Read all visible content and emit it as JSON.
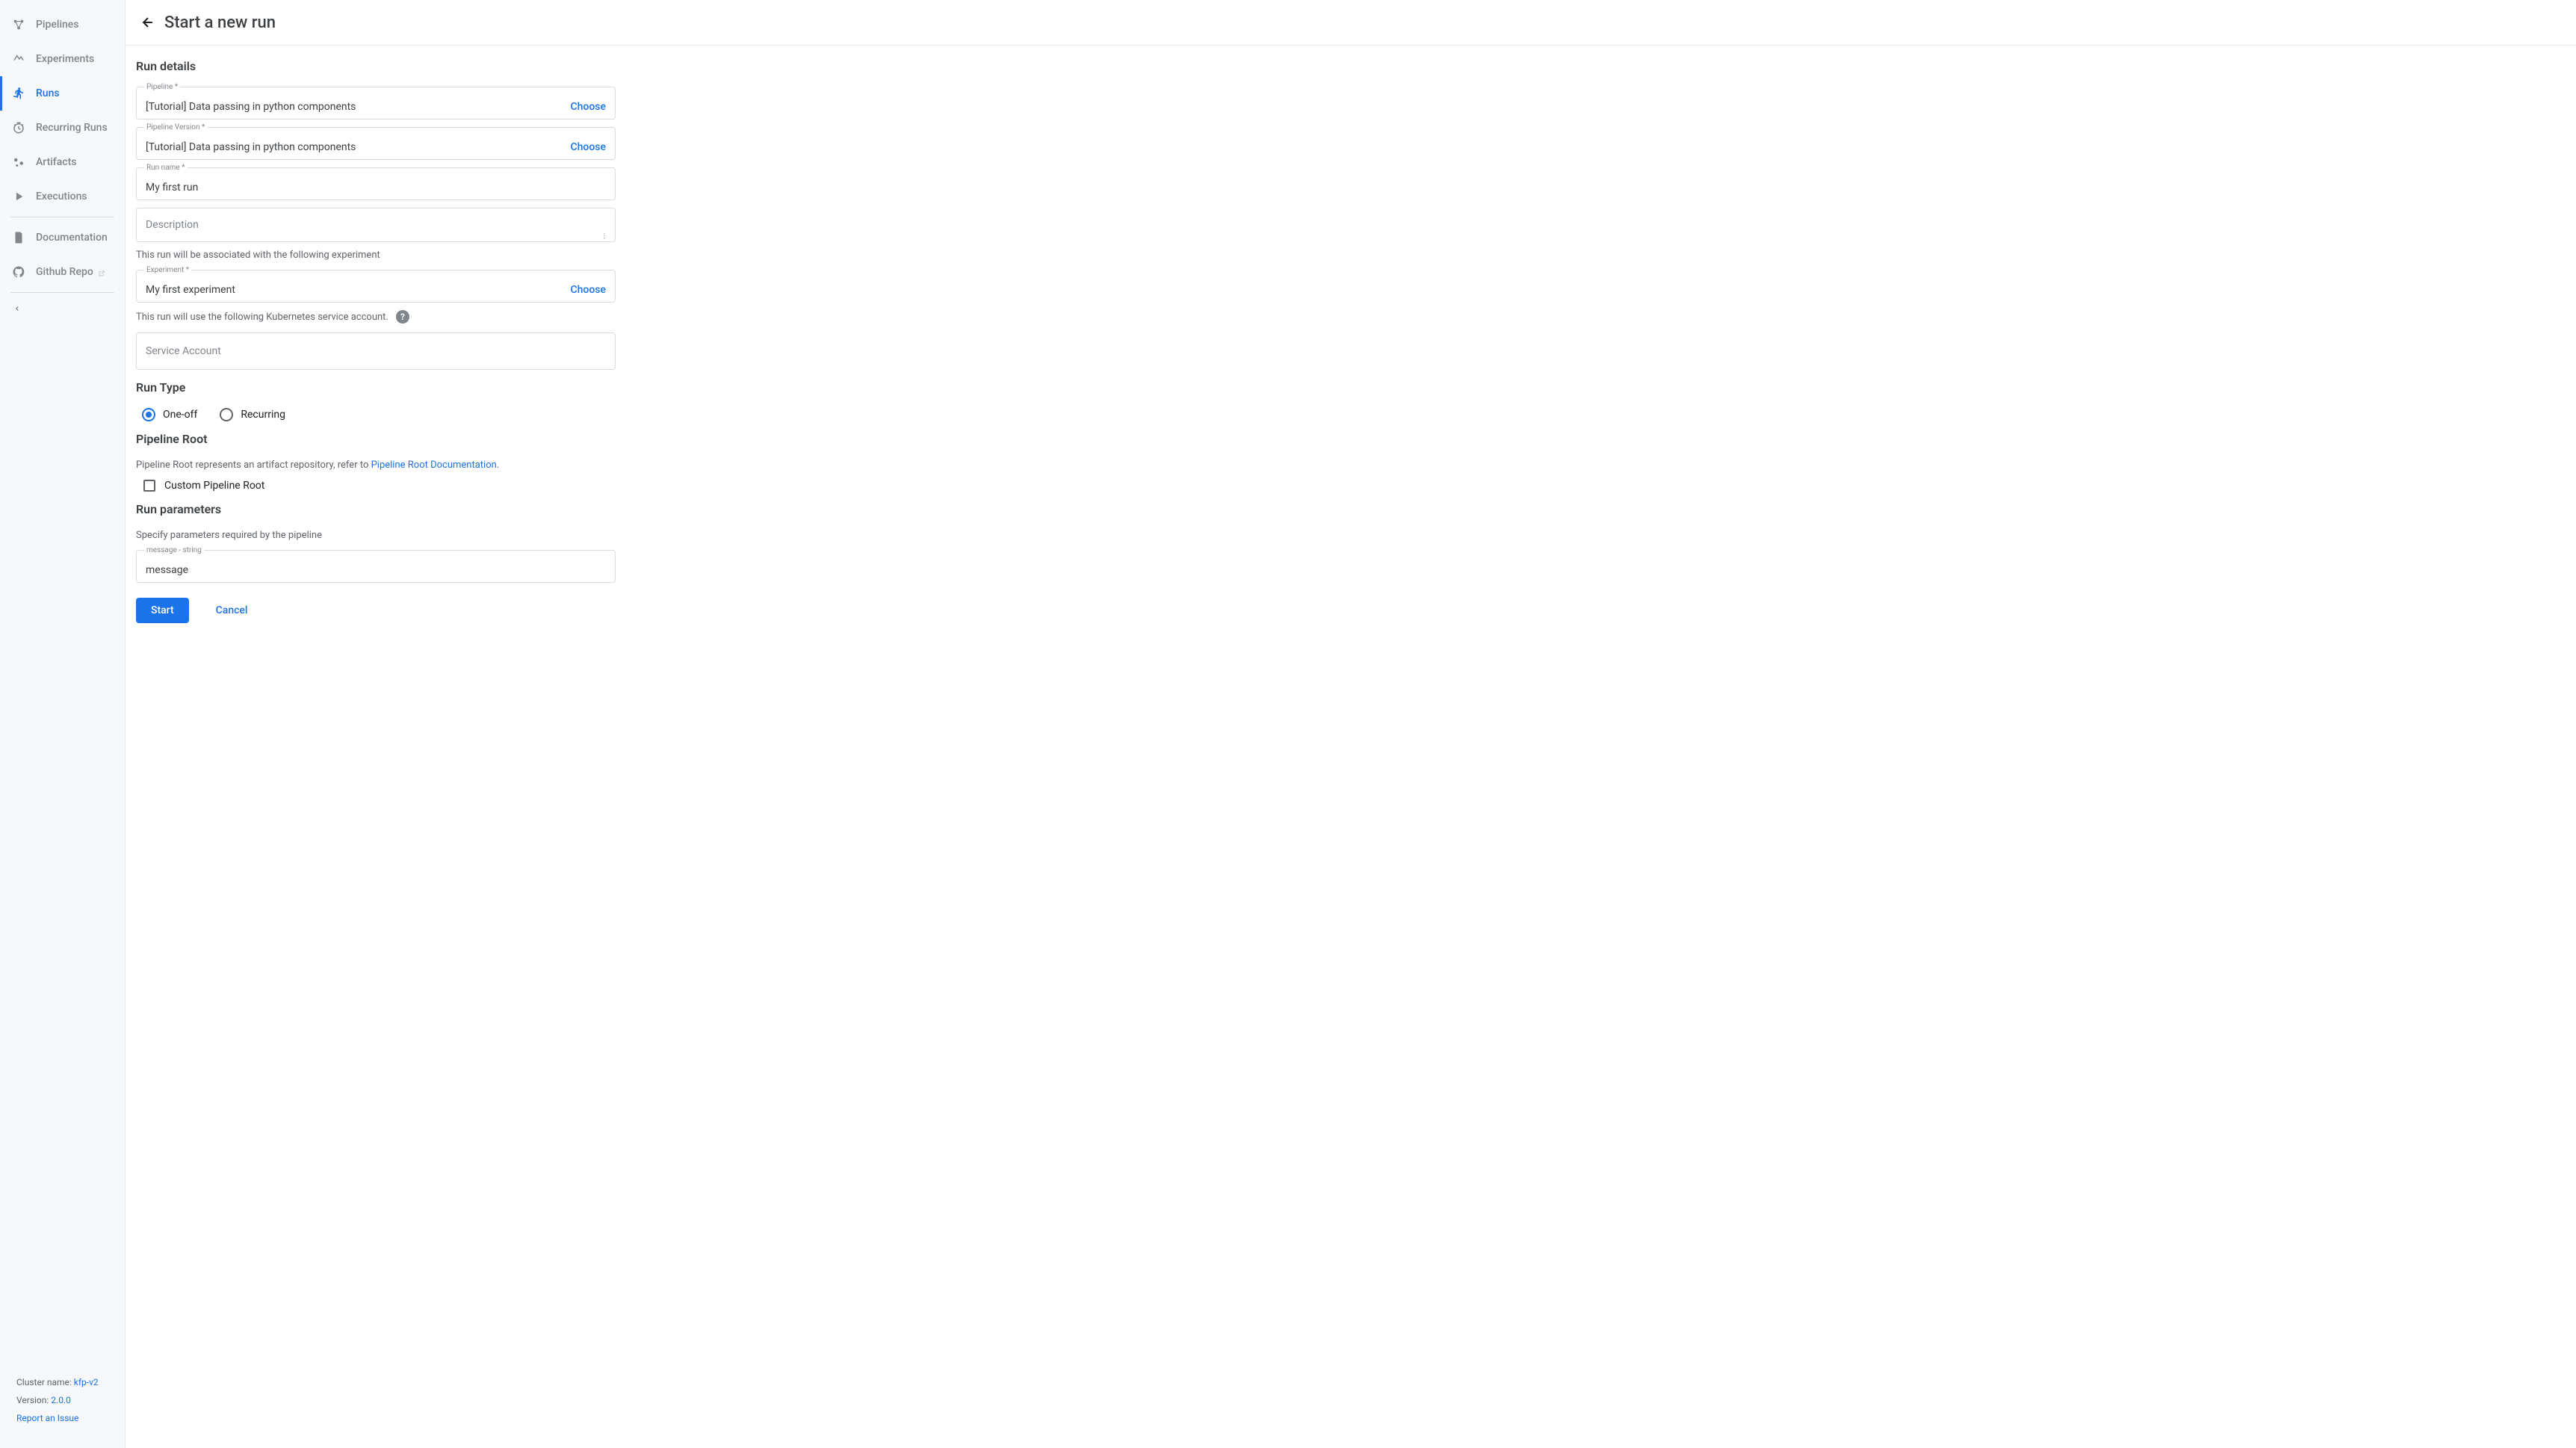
{
  "sidebar": {
    "items": [
      {
        "label": "Pipelines"
      },
      {
        "label": "Experiments"
      },
      {
        "label": "Runs"
      },
      {
        "label": "Recurring Runs"
      },
      {
        "label": "Artifacts"
      },
      {
        "label": "Executions"
      },
      {
        "label": "Documentation"
      },
      {
        "label": "Github Repo"
      }
    ],
    "footer": {
      "cluster_label": "Cluster name: ",
      "cluster_value": "kfp-v2",
      "version_label": "Version: ",
      "version_value": "2.0.0",
      "report_issue": "Report an Issue"
    }
  },
  "header": {
    "title": "Start a new run"
  },
  "sections": {
    "run_details": {
      "title": "Run details",
      "pipeline": {
        "label": "Pipeline *",
        "value": "[Tutorial] Data passing in python components",
        "choose": "Choose"
      },
      "pipeline_version": {
        "label": "Pipeline Version *",
        "value": "[Tutorial] Data passing in python components",
        "choose": "Choose"
      },
      "run_name": {
        "label": "Run name *",
        "value": "My first run"
      },
      "description": {
        "placeholder": "Description"
      },
      "experiment_helper": "This run will be associated with the following experiment",
      "experiment": {
        "label": "Experiment *",
        "value": "My first experiment",
        "choose": "Choose"
      },
      "service_account_helper": "This run will use the following Kubernetes service account.",
      "service_account": {
        "placeholder": "Service Account"
      }
    },
    "run_type": {
      "title": "Run Type",
      "one_off": "One-off",
      "recurring": "Recurring"
    },
    "pipeline_root": {
      "title": "Pipeline Root",
      "description_prefix": "Pipeline Root represents an artifact repository, refer to ",
      "link_text": "Pipeline Root Documentation",
      "description_suffix": ".",
      "checkbox_label": "Custom Pipeline Root"
    },
    "run_parameters": {
      "title": "Run parameters",
      "description": "Specify parameters required by the pipeline",
      "param": {
        "label": "message - string",
        "value": "message"
      }
    }
  },
  "buttons": {
    "start": "Start",
    "cancel": "Cancel"
  }
}
